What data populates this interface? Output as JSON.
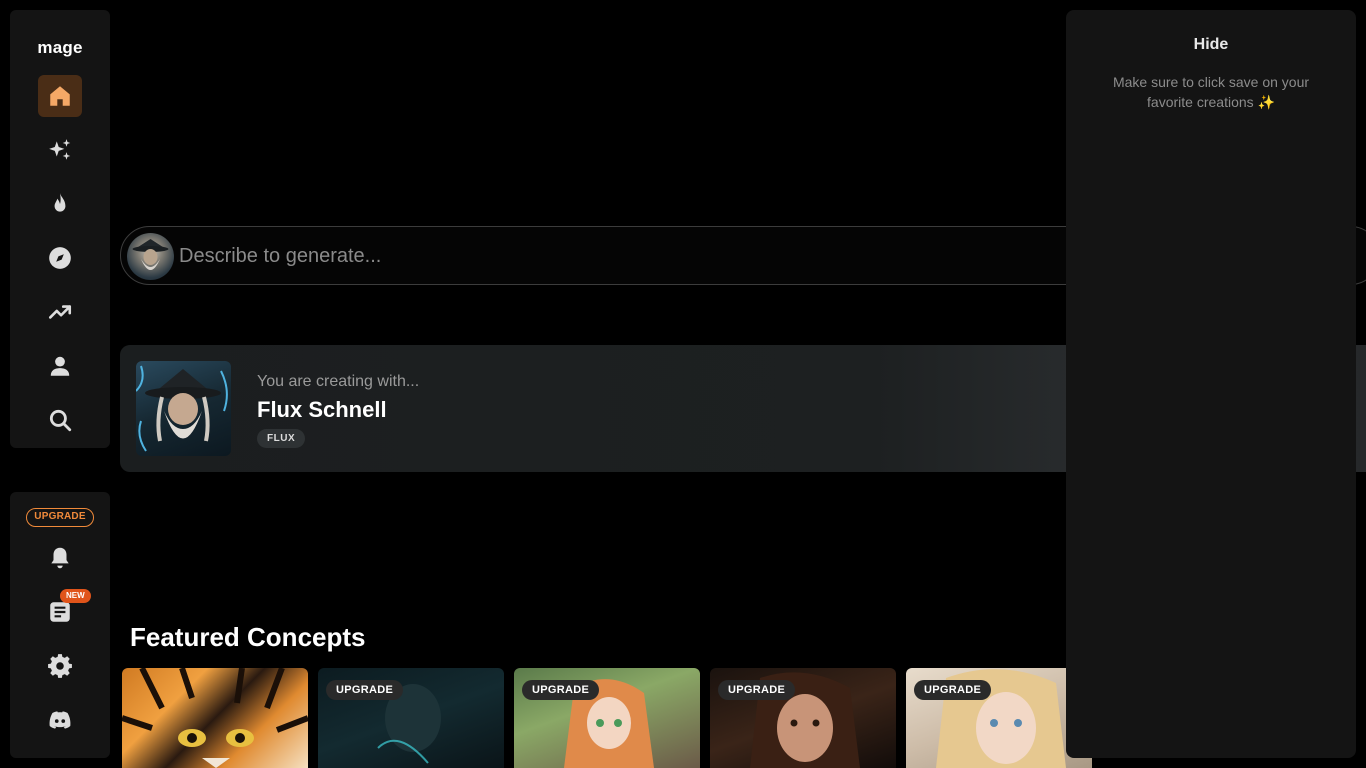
{
  "sidebar": {
    "logo": "mage",
    "nav_items": [
      {
        "icon": "home-icon",
        "active": true
      },
      {
        "icon": "sparkles-icon",
        "active": false
      },
      {
        "icon": "fire-icon",
        "active": false
      },
      {
        "icon": "compass-icon",
        "active": false
      },
      {
        "icon": "trending-icon",
        "active": false
      },
      {
        "icon": "user-icon",
        "active": false
      },
      {
        "icon": "search-icon",
        "active": false
      }
    ],
    "upgrade_label": "UPGRADE",
    "new_badge": "NEW",
    "bottom_items": [
      {
        "icon": "bell-icon"
      },
      {
        "icon": "news-icon"
      },
      {
        "icon": "gear-icon"
      },
      {
        "icon": "discord-icon"
      }
    ]
  },
  "prompt": {
    "placeholder": "Describe to generate..."
  },
  "model_card": {
    "subtitle": "You are creating with...",
    "name": "Flux Schnell",
    "tag": "FLUX"
  },
  "featured": {
    "title": "Featured Concepts",
    "concepts": [
      {
        "badge": ""
      },
      {
        "badge": "UPGRADE"
      },
      {
        "badge": "UPGRADE"
      },
      {
        "badge": "UPGRADE"
      },
      {
        "badge": "UPGRADE"
      }
    ]
  },
  "right_panel": {
    "hide_label": "Hide",
    "message": "Make sure to click save on your favorite creations ✨"
  },
  "colors": {
    "accent": "#f08a3a",
    "active_nav_bg": "#4a2d16",
    "new_badge": "#e0541a"
  }
}
